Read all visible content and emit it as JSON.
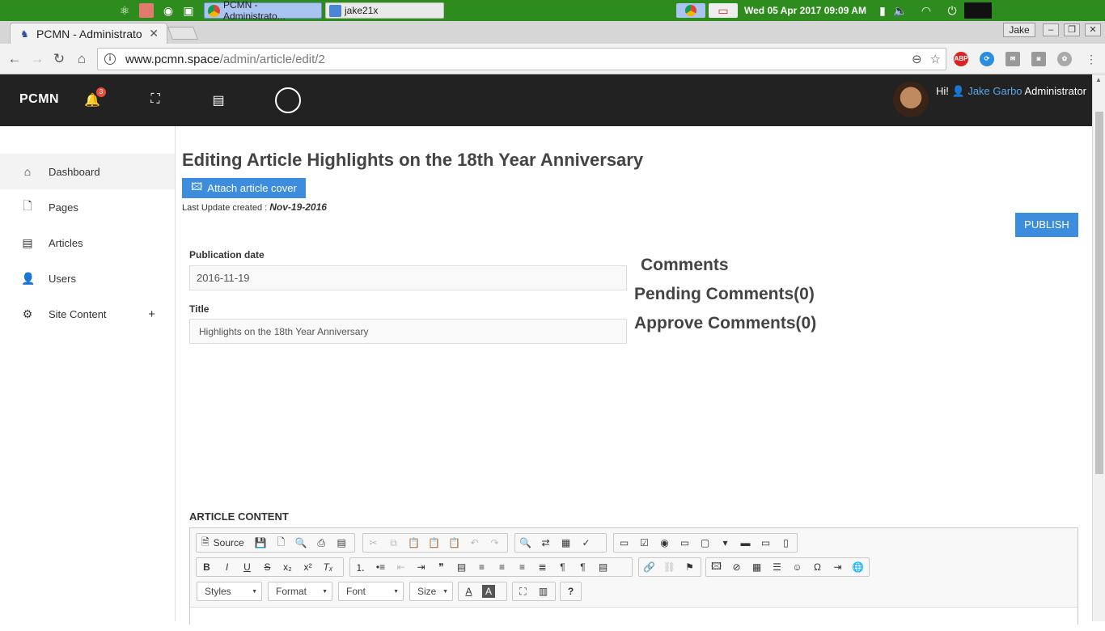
{
  "taskbar": {
    "tasks": [
      {
        "label": "PCMN - Administrato..."
      },
      {
        "label": "jake21x"
      }
    ],
    "clock": "Wed 05 Apr 2017  09:09 AM"
  },
  "browser": {
    "tab_title": "PCMN - Administrato",
    "profile": "Jake",
    "url_host": "www.pcmn.space",
    "url_path": "/admin/article/edit/2",
    "ext_abp": "ABP"
  },
  "header": {
    "brand": "PCMN",
    "notification_count": "3",
    "greeting": "Hi!",
    "user_name": "Jake Garbo",
    "user_role": "Administrator"
  },
  "sidebar": {
    "items": [
      {
        "label": "Dashboard",
        "icon": "home-icon"
      },
      {
        "label": "Pages",
        "icon": "file-icon"
      },
      {
        "label": "Articles",
        "icon": "document-icon"
      },
      {
        "label": "Users",
        "icon": "user-icon"
      },
      {
        "label": "Site Content",
        "icon": "gear-icon",
        "expander": "+"
      }
    ]
  },
  "main": {
    "title": "Editing Article Highlights on the 18th Year Anniversary",
    "attach_button": "Attach article cover",
    "last_update_label": "Last Update created :",
    "last_update_value": "Nov-19-2016",
    "publish_button": "PUBLISH",
    "pubdate_label": "Publication date",
    "pubdate_value": "2016-11-19",
    "title_label": "Title",
    "title_value": "Highlights on the 18th Year Anniversary",
    "content_label": "ARTICLE CONTENT"
  },
  "comments": {
    "heading": "Comments",
    "pending": "Pending Comments(0)",
    "approve": "Approve Comments(0)"
  },
  "editor": {
    "source_label": "Source",
    "styles": "Styles",
    "format": "Format",
    "font": "Font",
    "size": "Size"
  }
}
